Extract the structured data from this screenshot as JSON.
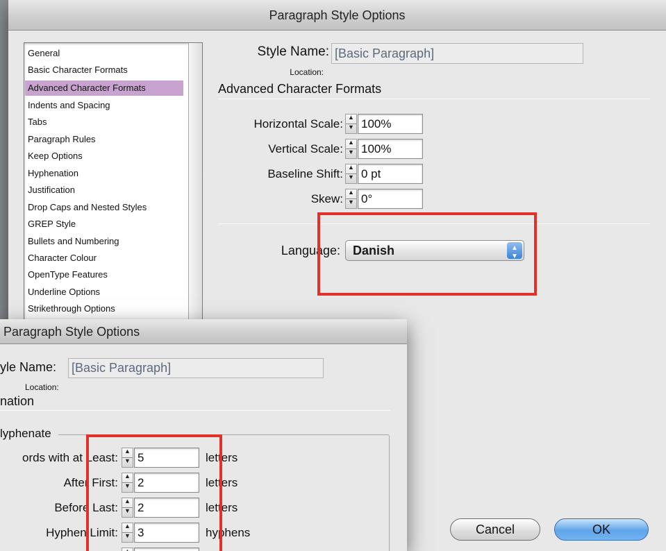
{
  "back_dialog": {
    "title": "Paragraph Style Options",
    "style_name_label": "Style Name:",
    "style_name_value": "[Basic Paragraph]",
    "location_label": "Location:",
    "section_title": "Advanced Character Formats",
    "categories": [
      "General",
      "Basic Character Formats",
      "Advanced Character Formats",
      "Indents and Spacing",
      "Tabs",
      "Paragraph Rules",
      "Keep Options",
      "Hyphenation",
      "Justification",
      "Drop Caps and Nested Styles",
      "GREP Style",
      "Bullets and Numbering",
      "Character Colour",
      "OpenType Features",
      "Underline Options",
      "Strikethrough Options"
    ],
    "selected_category": "Advanced Character Formats",
    "fields": [
      {
        "label": "Horizontal Scale:",
        "value": "100%"
      },
      {
        "label": "Vertical Scale:",
        "value": "100%"
      },
      {
        "label": "Baseline Shift:",
        "value": "0 pt"
      },
      {
        "label": "Skew:",
        "value": "0°"
      }
    ],
    "language_label": "Language:",
    "language_value": "Danish",
    "cancel_label": "Cancel",
    "ok_label": "OK"
  },
  "front_dialog": {
    "title": "Paragraph Style Options",
    "style_name_label": "yle Name:",
    "style_name_value": "[Basic Paragraph]",
    "location_label": "Location:",
    "section_title": "nation",
    "group_label": "lyphenate",
    "rows": [
      {
        "label": "ords with at Least:",
        "value": "5",
        "unit": "letters"
      },
      {
        "label": "After First:",
        "value": "2",
        "unit": "letters"
      },
      {
        "label": "Before Last:",
        "value": "2",
        "unit": "letters"
      },
      {
        "label": "Hyphen Limit:",
        "value": "3",
        "unit": "hyphens"
      }
    ]
  },
  "colors": {
    "highlight_box": "#e2302b",
    "selected_item": "#c9a3d0",
    "ok_button": "#5ea4ea"
  },
  "icons": {
    "stepper": "up-down-arrows-icon",
    "select": "popup-arrows-icon"
  }
}
